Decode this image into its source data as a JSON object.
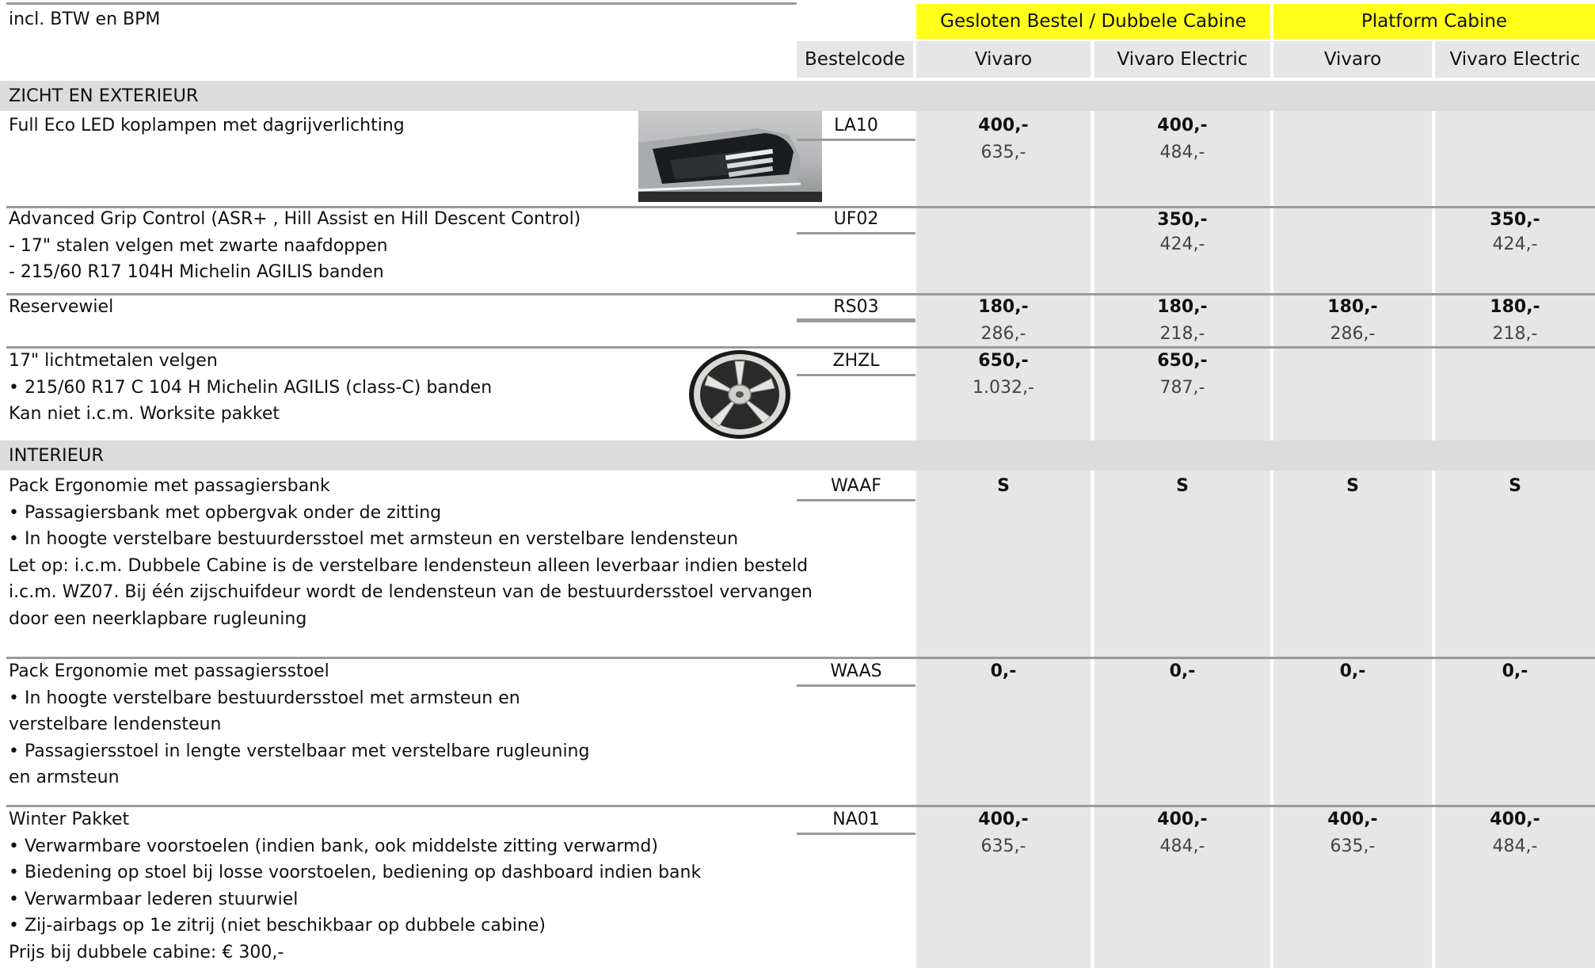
{
  "header": {
    "note": "incl. BTW en BPM",
    "group1": "Gesloten Bestel / Dubbele Cabine",
    "group2": "Platform Cabine",
    "columns": {
      "code": "Bestelcode",
      "c1": "Vivaro",
      "c2": "Vivaro Electric",
      "c3": "Vivaro",
      "c4": "Vivaro Electric"
    }
  },
  "colors": {
    "group_header_bg": "#ffff19",
    "section_bg": "#dcdcdc",
    "cell_bg": "#e6e6e6"
  },
  "sections": {
    "s1": "ZICHT EN EXTERIEUR",
    "s2": "INTERIEUR"
  },
  "rows": {
    "r1": {
      "lines": [
        "Full Eco LED koplampen met dagrijverlichting"
      ],
      "image": "led-headlight-image",
      "code": "LA10",
      "prices": [
        [
          "400,-",
          "635,-"
        ],
        [
          "400,-",
          "484,-"
        ],
        [
          "",
          ""
        ],
        [
          "",
          ""
        ]
      ]
    },
    "r2": {
      "lines": [
        "Advanced Grip Control (ASR+ , Hill Assist en Hill Descent Control)",
        "- 17\" stalen velgen met zwarte naafdoppen",
        "- 215/60 R17 104H Michelin AGILIS banden"
      ],
      "code": "UF02",
      "prices": [
        [
          "",
          ""
        ],
        [
          "350,-",
          "424,-"
        ],
        [
          "",
          ""
        ],
        [
          "350,-",
          "424,-"
        ]
      ]
    },
    "r3": {
      "lines": [
        "Reservewiel"
      ],
      "code": "RS03",
      "prices": [
        [
          "180,-",
          "286,-"
        ],
        [
          "180,-",
          "218,-"
        ],
        [
          "180,-",
          "286,-"
        ],
        [
          "180,-",
          "218,-"
        ]
      ]
    },
    "r4": {
      "lines": [
        "17\" lichtmetalen velgen",
        "• 215/60 R17 C 104 H Michelin AGILIS (class-C) banden",
        "Kan niet i.c.m. Worksite pakket"
      ],
      "image": "alloy-wheel-image",
      "code": "ZHZL",
      "prices": [
        [
          "650,-",
          "1.032,-"
        ],
        [
          "650,-",
          "787,-"
        ],
        [
          "",
          ""
        ],
        [
          "",
          ""
        ]
      ]
    },
    "r5": {
      "lines": [
        "Pack Ergonomie met passagiersbank",
        "• Passagiersbank met opbergvak onder de zitting",
        "• In hoogte verstelbare bestuurdersstoel met armsteun en verstelbare lendensteun",
        "Let op: i.c.m. Dubbele Cabine is de verstelbare lendensteun alleen leverbaar indien besteld",
        "i.c.m. WZ07. Bij één zijschuifdeur wordt de lendensteun van de bestuurdersstoel vervangen",
        "door een neerklapbare rugleuning"
      ],
      "code": "WAAF",
      "prices": [
        [
          "S",
          ""
        ],
        [
          "S",
          ""
        ],
        [
          "S",
          ""
        ],
        [
          "S",
          ""
        ]
      ]
    },
    "r6": {
      "lines": [
        "Pack Ergonomie met passagiersstoel",
        "• In hoogte verstelbare bestuurdersstoel met armsteun en",
        "verstelbare lendensteun",
        "• Passagiersstoel in lengte verstelbaar met verstelbare rugleuning",
        "en armsteun"
      ],
      "code": "WAAS",
      "prices": [
        [
          "0,-",
          ""
        ],
        [
          "0,-",
          ""
        ],
        [
          "0,-",
          ""
        ],
        [
          "0,-",
          ""
        ]
      ]
    },
    "r7": {
      "lines": [
        "Winter Pakket",
        "• Verwarmbare voorstoelen (indien bank, ook middelste zitting verwarmd)",
        "• Biedening op stoel bij losse voorstoelen, bediening op dashboard indien bank",
        "• Verwarmbaar lederen stuurwiel",
        "• Zij-airbags op 1e zitrij (niet beschikbaar op dubbele cabine)",
        "Prijs bij dubbele cabine: € 300,-"
      ],
      "code": "NA01",
      "prices": [
        [
          "400,-",
          "635,-"
        ],
        [
          "400,-",
          "484,-"
        ],
        [
          "400,-",
          "635,-"
        ],
        [
          "400,-",
          "484,-"
        ]
      ]
    }
  }
}
